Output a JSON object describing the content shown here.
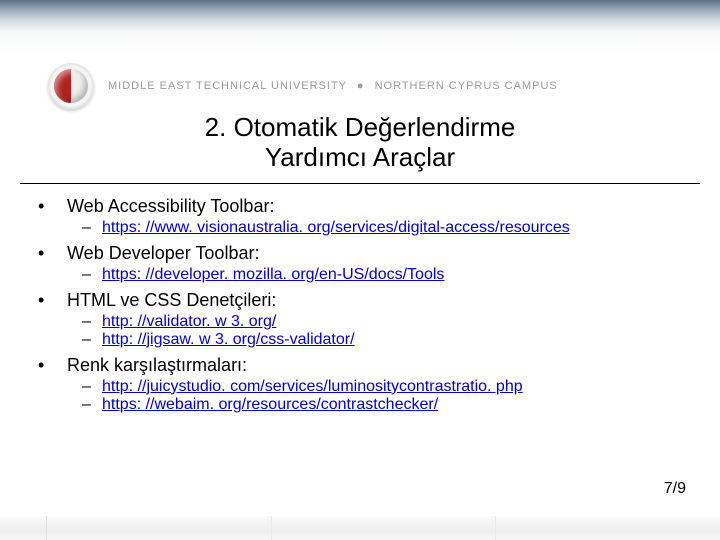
{
  "header": {
    "university_left": "MIDDLE EAST TECHNICAL UNIVERSITY",
    "dot": "●",
    "university_right": "NORTHERN CYPRUS CAMPUS"
  },
  "title_line1": "2. Otomatik Değerlendirme",
  "title_line2": "Yardımcı Araçlar",
  "items": [
    {
      "label": "Web Accessibility Toolbar:",
      "links": [
        "https: //www. visionaustralia. org/services/digital-access/resources"
      ]
    },
    {
      "label": "Web Developer Toolbar:",
      "links": [
        "https: //developer. mozilla. org/en-US/docs/Tools"
      ]
    },
    {
      "label": "HTML ve CSS Denetçileri:",
      "links": [
        "http: //validator. w 3. org/",
        "http: //jigsaw. w 3. org/css-validator/"
      ]
    },
    {
      "label": "Renk karşılaştırmaları:",
      "links": [
        "http: //juicystudio. com/services/luminositycontrastratio. php",
        "https: //webaim. org/resources/contrastchecker/"
      ]
    }
  ],
  "page_number": "7/9"
}
